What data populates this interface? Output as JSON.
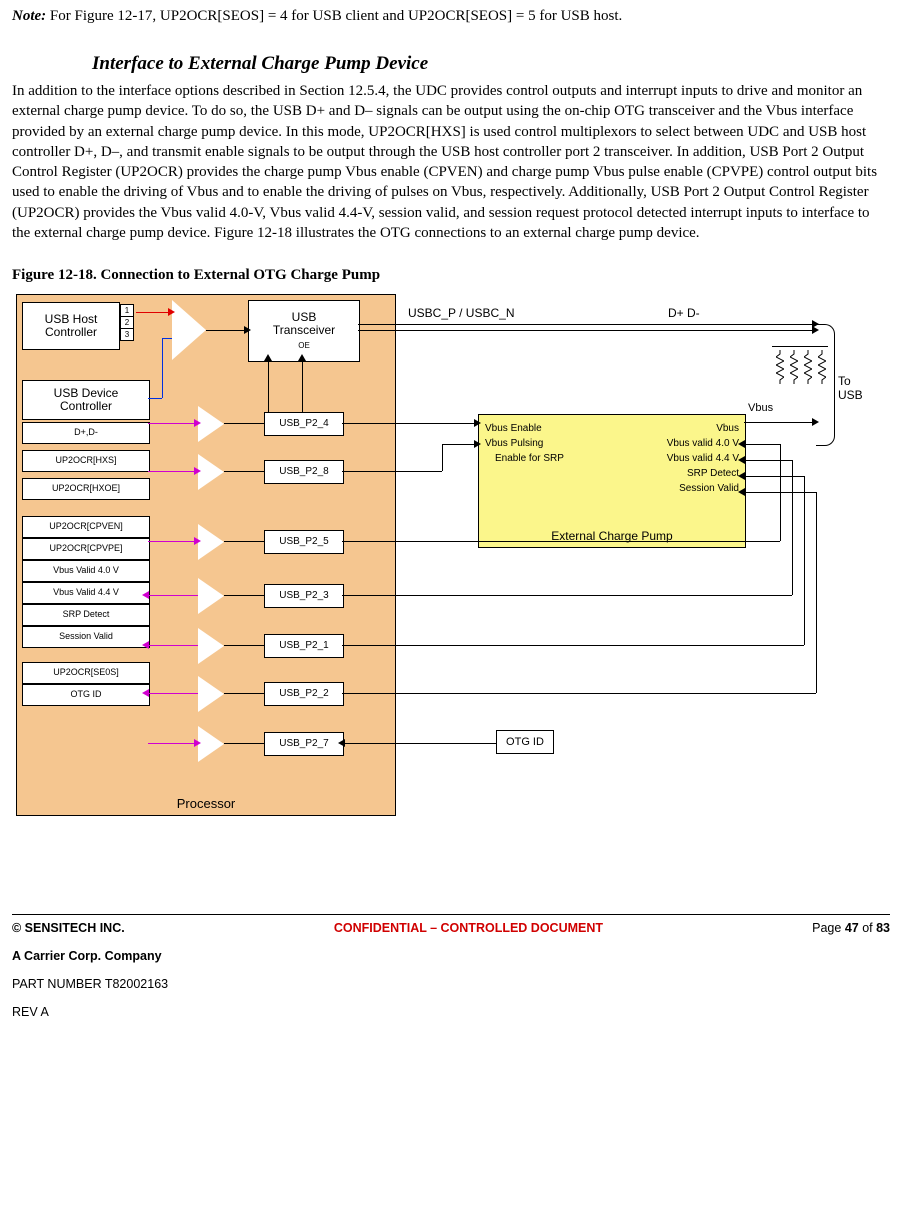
{
  "note": {
    "label": "Note:",
    "text": "For Figure 12-17, UP2OCR[SEOS] = 4 for USB client and UP2OCR[SEOS] = 5 for USB host."
  },
  "section_heading": "Interface to External Charge Pump Device",
  "body_paragraph": "In addition to the interface options described in Section 12.5.4, the UDC provides control outputs and interrupt inputs to drive and monitor an external charge pump device. To do so, the USB D+ and D– signals can be output using the on-chip OTG transceiver and the Vbus interface provided by an external charge pump device. In this mode, UP2OCR[HXS] is used control multiplexors to select between UDC and USB host controller D+, D–, and transmit enable signals to be output through the USB host controller port 2 transceiver. In addition, USB Port 2 Output Control Register (UP2OCR) provides the charge pump Vbus enable (CPVEN) and charge pump Vbus pulse enable (CPVPE) control output bits used to enable the driving of Vbus and to enable the driving of pulses on Vbus, respectively. Additionally, USB Port 2 Output Control Register (UP2OCR) provides the Vbus valid 4.0-V, Vbus valid 4.4-V, session valid, and session request protocol detected interrupt inputs to interface to the external charge pump device. Figure 12-18 illustrates the OTG connections to an external charge pump device.",
  "figure_caption": "Figure 12-18. Connection to External OTG Charge Pump",
  "diagram": {
    "processor_label": "Processor",
    "host_controller": "USB Host\nController",
    "host_ports": [
      "1",
      "2",
      "3"
    ],
    "device_controller": "USB Device\nController",
    "registers": [
      "D+,D-",
      "UP2OCR[HXS]",
      "UP2OCR[HXOE]",
      "UP2OCR[CPVEN]",
      "UP2OCR[CPVPE]",
      "Vbus Valid 4.0 V",
      "Vbus Valid 4.4 V",
      "SRP Detect",
      "Session Valid",
      "UP2OCR[SE0S]",
      "OTG ID"
    ],
    "usb_transceiver": "USB\nTransceiver",
    "usb_transceiver_sub": "OE",
    "ports": {
      "p4": "USB_P2_4",
      "p8": "USB_P2_8",
      "p5": "USB_P2_5",
      "p3": "USB_P2_3",
      "p1": "USB_P2_1",
      "p2": "USB_P2_2",
      "p7": "USB_P2_7"
    },
    "top_signal": "USBC_P / USBC_N",
    "dplus_dminus": "D+ D-",
    "vbus_label": "Vbus",
    "to_usb": "To USB",
    "charge_pump": {
      "title": "External Charge Pump",
      "left": [
        "Vbus Enable",
        "Vbus Pulsing",
        "Enable for SRP"
      ],
      "right": [
        "Vbus",
        "Vbus valid 4.0 V",
        "Vbus valid 4.4 V",
        "SRP Detect",
        "Session Valid"
      ]
    },
    "otgid": "OTG ID"
  },
  "footer": {
    "left": "© SENSITECH INC.",
    "mid": "CONFIDENTIAL – CONTROLLED DOCUMENT",
    "right_prefix": "Page ",
    "page_current": "47",
    "right_mid": " of ",
    "page_total": "83",
    "line2": "A Carrier Corp. Company",
    "line3": "PART NUMBER T82002163",
    "line4": "REV A"
  }
}
